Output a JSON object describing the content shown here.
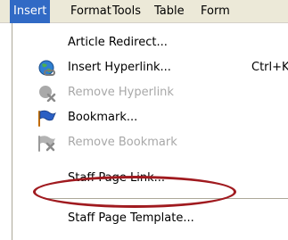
{
  "menubar": {
    "items": [
      "Insert",
      "Format",
      "Tools",
      "Table",
      "Form"
    ],
    "active": "Insert"
  },
  "menu": {
    "items": [
      {
        "label": "Article Redirect...",
        "icon": null,
        "enabled": true,
        "shortcut": ""
      },
      {
        "label": "Insert Hyperlink...",
        "icon": "globe-link-icon",
        "enabled": true,
        "shortcut": "Ctrl+K"
      },
      {
        "label": "Remove Hyperlink",
        "icon": "remove-link-icon",
        "enabled": false,
        "shortcut": ""
      },
      {
        "label": "Bookmark...",
        "icon": "bookmark-flag-icon",
        "enabled": true,
        "shortcut": ""
      },
      {
        "label": "Remove Bookmark",
        "icon": "remove-bookmark-icon",
        "enabled": false,
        "shortcut": ""
      },
      {
        "label": "Staff Page Link...",
        "icon": null,
        "enabled": true,
        "shortcut": "",
        "annotated": true
      },
      {
        "label": "Staff Page Template...",
        "icon": null,
        "enabled": true,
        "shortcut": ""
      }
    ]
  },
  "colors": {
    "menubar_bg": "#ece9d8",
    "active_bg": "#316ac5",
    "disabled_text": "#a8a8a8",
    "annotation_ellipse": "#a01a1f"
  }
}
